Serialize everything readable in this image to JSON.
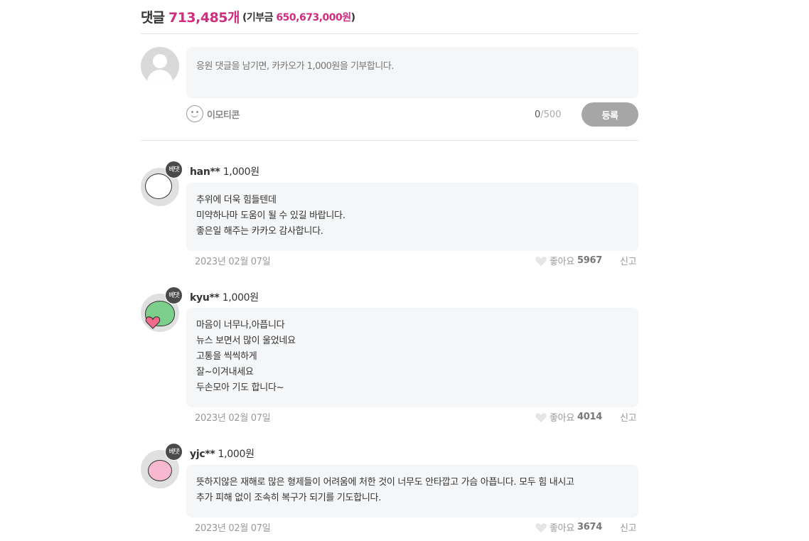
{
  "header": {
    "title": "댓글",
    "count": "713,485개",
    "donate_prefix": "(기부금 ",
    "donate_amount": "650,673,000원",
    "donate_suffix": ")"
  },
  "write": {
    "placeholder": "응원 댓글을 남기면, 카카오가 1,000원을 기부합니다.",
    "emoticon_label": "이모티콘",
    "counter_current": "0",
    "counter_max": "/500",
    "submit_label": "등록"
  },
  "comments": [
    {
      "badge": "베댓",
      "user": "han**",
      "amount": "1,000원",
      "lines": [
        "추위에 더욱 힘들텐데",
        "미약하나마 도움이 될 수 있길 바랍니다.",
        "좋은일 해주는 카카오 감사합니다."
      ],
      "date": "2023년 02월 07일",
      "like_label": "좋아요",
      "like_count": "5967",
      "report_label": "신고"
    },
    {
      "badge": "베댓",
      "user": "kyu**",
      "amount": "1,000원",
      "lines": [
        "마음이 너무나,아픕니다",
        "뉴스 보면서 많이 울었네요",
        "고통을 씩씩하게",
        "잘~이겨내세요",
        "두손모아 기도 합니다~"
      ],
      "date": "2023년 02월 07일",
      "like_label": "좋아요",
      "like_count": "4014",
      "report_label": "신고"
    },
    {
      "badge": "베댓",
      "user": "yjc**",
      "amount": "1,000원",
      "lines": [
        "뜻하지않은 재해로 많은 형제들이 어려움에 처한 것이 너무도 안타깝고 가슴 아픕니다. 모두 힘 내시고",
        "추가 피해 없이 조속히 복구가 되기를 기도합니다."
      ],
      "date": "2023년 02월 07일",
      "like_label": "좋아요",
      "like_count": "3674",
      "report_label": "신고"
    }
  ]
}
